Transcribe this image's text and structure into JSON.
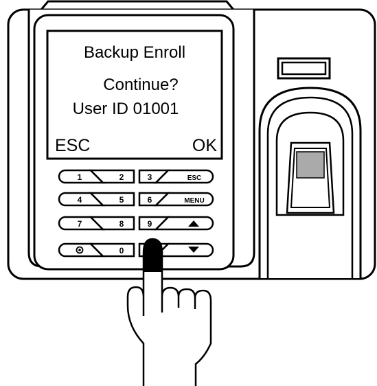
{
  "screen": {
    "line1": "Backup Enroll",
    "line2": "Continue?",
    "line3": "User ID 01001",
    "left_softkey": "ESC",
    "right_softkey": "OK"
  },
  "keypad": {
    "row1": [
      "1",
      "2",
      "3",
      "ESC"
    ],
    "row2": [
      "4",
      "5",
      "6",
      "MENU"
    ],
    "row3": [
      "7",
      "8",
      "9",
      "up-arrow"
    ],
    "row4": [
      "power",
      "0",
      "",
      "down-arrow"
    ]
  },
  "pressed_key": "row4 key 3"
}
